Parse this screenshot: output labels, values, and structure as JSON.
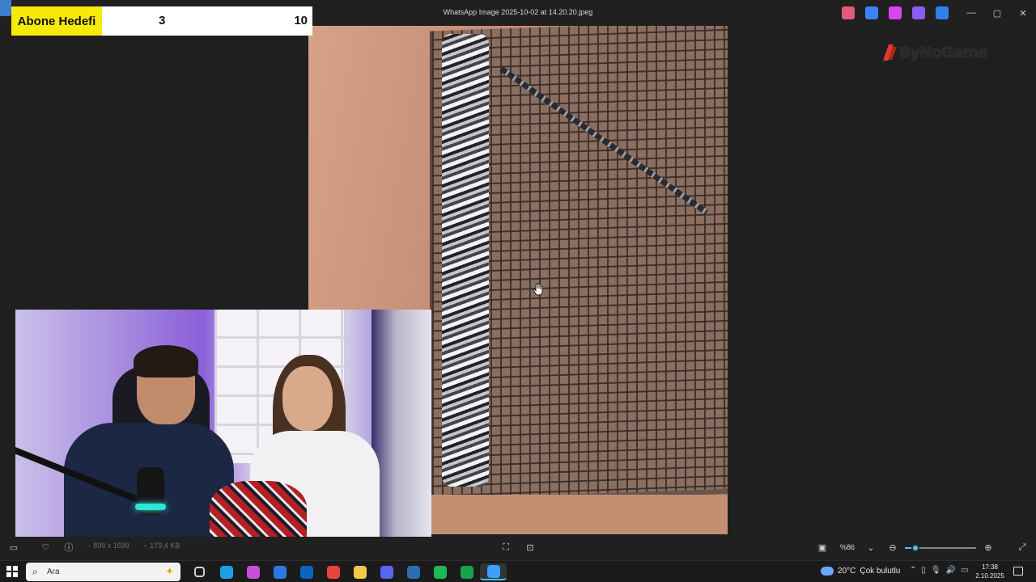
{
  "window": {
    "title": "WhatsApp Image 2025-10-02 at 14.20.20.jpeg",
    "controls": {
      "minimize": "—",
      "maximize": "▢",
      "close": "✕"
    },
    "titlebar_apps": [
      {
        "name": "copilot-icon",
        "color": "#e05a7a"
      },
      {
        "name": "edit-icon",
        "color": "#3b82f6"
      },
      {
        "name": "clipchamp-icon",
        "color": "#d946ef"
      },
      {
        "name": "designer-icon",
        "color": "#8b5cf6"
      },
      {
        "name": "onedrive-icon",
        "color": "#2f80ed"
      }
    ]
  },
  "overlay": {
    "goal_label": "Abone Hedefi",
    "goal_current": "3",
    "goal_target": "10",
    "brand": "ByNoGame"
  },
  "viewer_bar": {
    "dimensions": "899 x 1599",
    "file_size": "179,4 KB",
    "zoom": "%86",
    "zoom_fraction": 0.15
  },
  "taskbar": {
    "search_placeholder": "Ara",
    "weather_temp": "20°C",
    "weather_desc": "Çok bulutlu",
    "time": "17:38",
    "date": "2.10.2025",
    "apps": [
      {
        "name": "task-view-icon",
        "color": "#5a5a5a"
      },
      {
        "name": "edge-icon",
        "color": "#1da1e6"
      },
      {
        "name": "copilot-icon",
        "color": "#c84fd8"
      },
      {
        "name": "store-icon",
        "color": "#2b78e4"
      },
      {
        "name": "outlook-icon",
        "color": "#0a64c2"
      },
      {
        "name": "chrome-icon",
        "color": "#e8453c"
      },
      {
        "name": "file-explorer-icon",
        "color": "#f2c94c"
      },
      {
        "name": "discord-icon",
        "color": "#5865f2"
      },
      {
        "name": "steam-icon",
        "color": "#2a6fb0"
      },
      {
        "name": "spotify-icon",
        "color": "#1db954"
      },
      {
        "name": "xbox-icon",
        "color": "#16a34a"
      },
      {
        "name": "photos-icon",
        "color": "#3ba0ff"
      }
    ]
  }
}
